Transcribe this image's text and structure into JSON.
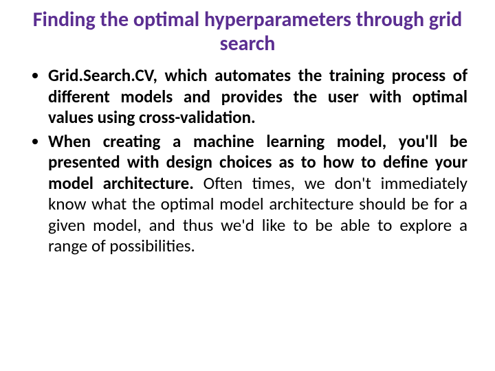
{
  "title": "Finding the optimal hyperparameters through grid search",
  "bullets": [
    {
      "bold": "Grid.Search.CV, which automates the training process of different models and provides the user with optimal values using cross-validation.",
      "rest": ""
    },
    {
      "bold": "When creating a machine learning model, you'll be presented with design choices as to how to define your model architecture.",
      "rest": " Often times, we don't immediately know what the optimal model architecture should be for a given model, and thus we'd like to be able to explore a range of possibilities."
    }
  ]
}
